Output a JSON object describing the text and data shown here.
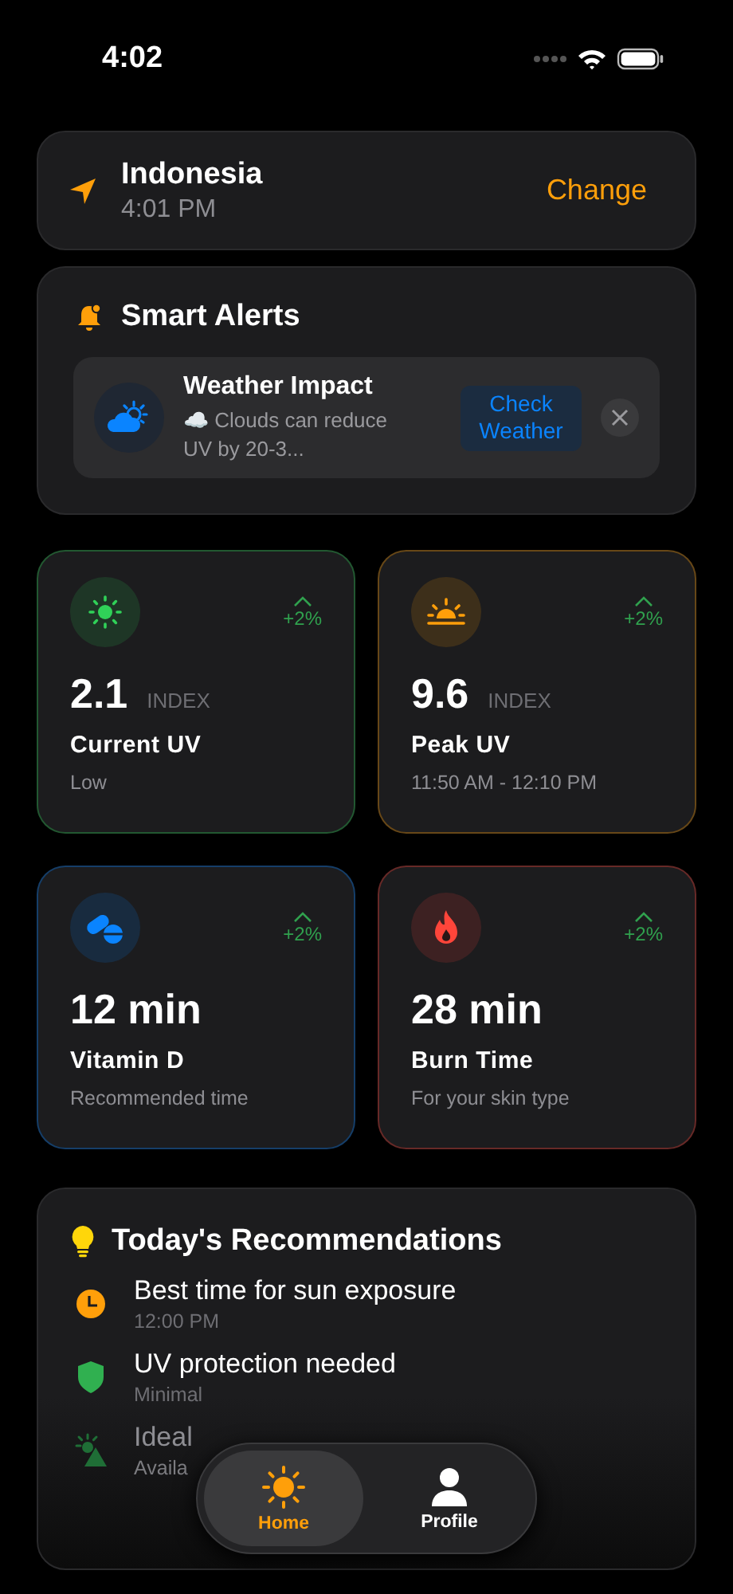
{
  "status_bar": {
    "time": "4:02"
  },
  "location": {
    "name": "Indonesia",
    "time": "4:01 PM",
    "action": "Change"
  },
  "smart_alerts": {
    "title": "Smart Alerts",
    "alert": {
      "title": "Weather Impact",
      "message": "☁️ Clouds can reduce UV by 20-3...",
      "button": "Check Weather"
    }
  },
  "metrics": [
    {
      "kind": "sun",
      "color": "#30d158",
      "value": "2.1",
      "unit": "INDEX",
      "label": "Current UV",
      "caption": "Low",
      "trend": "+2%"
    },
    {
      "kind": "sunrise",
      "color": "#ff9f0a",
      "value": "9.6",
      "unit": "INDEX",
      "label": "Peak UV",
      "caption": "11:50 AM - 12:10 PM",
      "trend": "+2%"
    },
    {
      "kind": "pills",
      "color": "#0a84ff",
      "value": "12 min",
      "label": "Vitamin D",
      "caption": "Recommended time",
      "trend": "+2%"
    },
    {
      "kind": "flame",
      "color": "#ff453a",
      "value": "28 min",
      "label": "Burn Time",
      "caption": "For your skin type",
      "trend": "+2%"
    }
  ],
  "recommendations": {
    "title": "Today's Recommendations",
    "items": [
      {
        "kind": "clock",
        "color": "#ff9f0a",
        "title": "Best time for sun exposure",
        "subtitle": "12:00 PM",
        "dimmed": false
      },
      {
        "kind": "shield",
        "color": "#30b050",
        "title": "UV protection needed",
        "subtitle": "Minimal",
        "dimmed": false
      },
      {
        "kind": "warning",
        "color": "#1f6e36",
        "title": "Ideal",
        "subtitle": "Availa",
        "dimmed": true
      }
    ]
  },
  "tab_bar": [
    {
      "label": "Home",
      "kind": "home",
      "selected": true
    },
    {
      "label": "Profile",
      "kind": "profile",
      "selected": false
    }
  ]
}
